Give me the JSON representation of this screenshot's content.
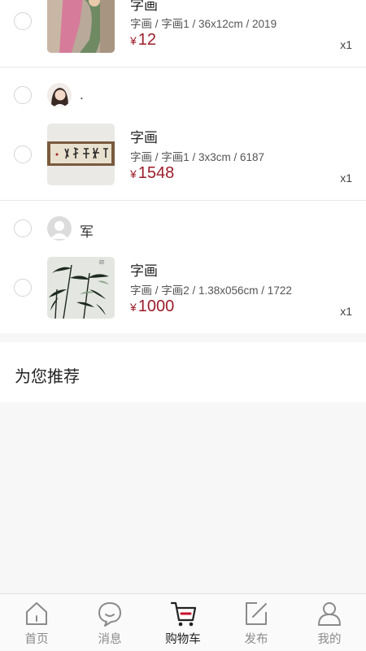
{
  "cart": {
    "shops": [
      {
        "seller_name": "",
        "items": [
          {
            "title": "字画",
            "meta": "字画 / 字画1 / 36x12cm / 2019",
            "currency": "¥",
            "price": "12",
            "qty": "x1"
          }
        ]
      },
      {
        "seller_name": ".",
        "items": [
          {
            "title": "字画",
            "meta": "字画 / 字画1 / 3x3cm / 6187",
            "currency": "¥",
            "price": "1548",
            "qty": "x1"
          }
        ]
      },
      {
        "seller_name": "军",
        "items": [
          {
            "title": "字画",
            "meta": "字画 / 字画2 / 1.38x056cm / 1722",
            "currency": "¥",
            "price": "1000",
            "qty": "x1"
          }
        ]
      }
    ]
  },
  "recommend": {
    "title": "为您推荐"
  },
  "tabbar": {
    "active": "购物车",
    "accent": "#c8102e",
    "items": [
      {
        "label": "首页",
        "icon": "home-icon"
      },
      {
        "label": "消息",
        "icon": "chat-bubble-icon"
      },
      {
        "label": "购物车",
        "icon": "cart-icon"
      },
      {
        "label": "发布",
        "icon": "edit-icon"
      },
      {
        "label": "我的",
        "icon": "user-icon"
      }
    ]
  }
}
